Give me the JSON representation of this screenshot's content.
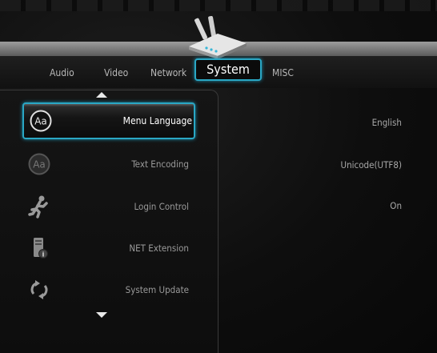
{
  "tabs": [
    {
      "label": "Audio",
      "selected": false
    },
    {
      "label": "Video",
      "selected": false
    },
    {
      "label": "Network",
      "selected": false
    },
    {
      "label": "System",
      "selected": true
    },
    {
      "label": "MISC",
      "selected": false
    }
  ],
  "menu": [
    {
      "label": "Menu Language",
      "icon": "text-aa-icon",
      "selected": true
    },
    {
      "label": "Text Encoding",
      "icon": "text-aa-icon",
      "selected": false
    },
    {
      "label": "Login Control",
      "icon": "running-person-icon",
      "selected": false
    },
    {
      "label": "NET Extension",
      "icon": "info-device-icon",
      "selected": false
    },
    {
      "label": "System Update",
      "icon": "refresh-icon",
      "selected": false
    }
  ],
  "values": [
    "English",
    "Unicode(UTF8)",
    "On"
  ],
  "colors": {
    "highlight": "#2aa7c4"
  }
}
